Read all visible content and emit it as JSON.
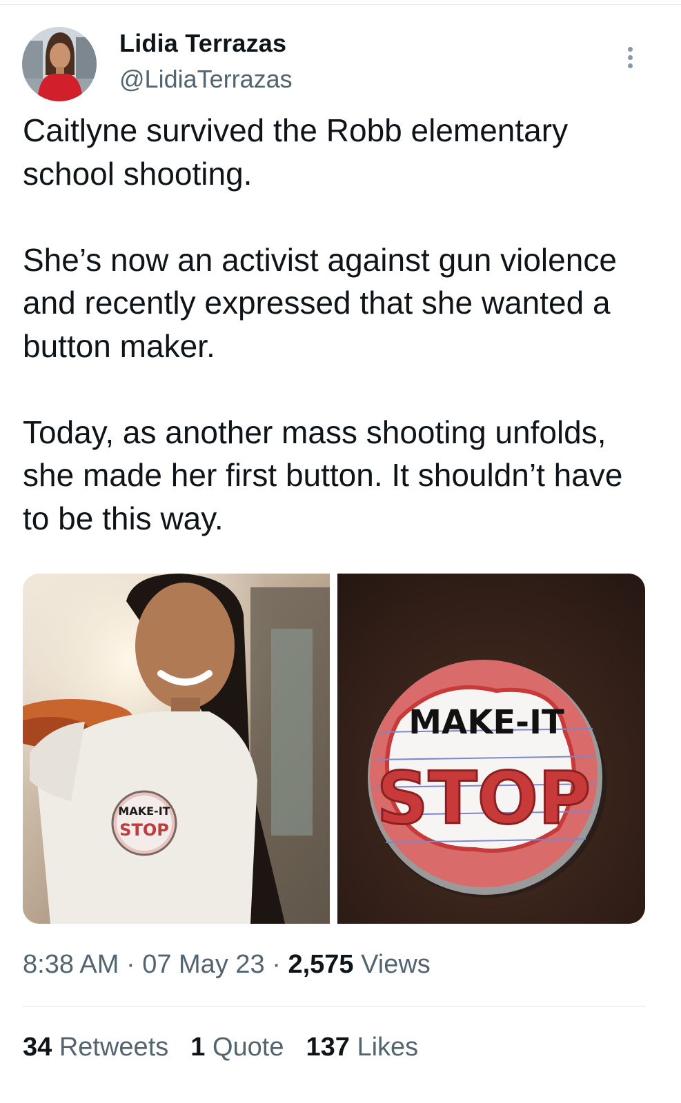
{
  "author": {
    "display_name": "Lidia Terrazas",
    "handle": "@LidiaTerrazas"
  },
  "tweet": {
    "paragraphs": [
      "Caitlyne survived the Robb elementary school shooting.",
      "She’s now an activist against gun violence and recently expressed that she wanted a button maker.",
      "Today, as another mass shooting unfolds, she made her first button. It shouldn’t have to be this way."
    ]
  },
  "media": {
    "button_text_top": "MAKE-IT",
    "button_text_bottom": "STOP"
  },
  "meta": {
    "time": "8:38 AM",
    "separator": "·",
    "date": "07 May 23",
    "views_count": "2,575",
    "views_label": "Views"
  },
  "stats": {
    "retweets_count": "34",
    "retweets_label": "Retweets",
    "quotes_count": "1",
    "quotes_label": "Quote",
    "likes_count": "137",
    "likes_label": "Likes"
  },
  "colors": {
    "text_primary": "#0f1419",
    "text_secondary": "#536471",
    "divider": "#e1e5e8"
  },
  "icons": {
    "more": "more-vertical-icon"
  }
}
